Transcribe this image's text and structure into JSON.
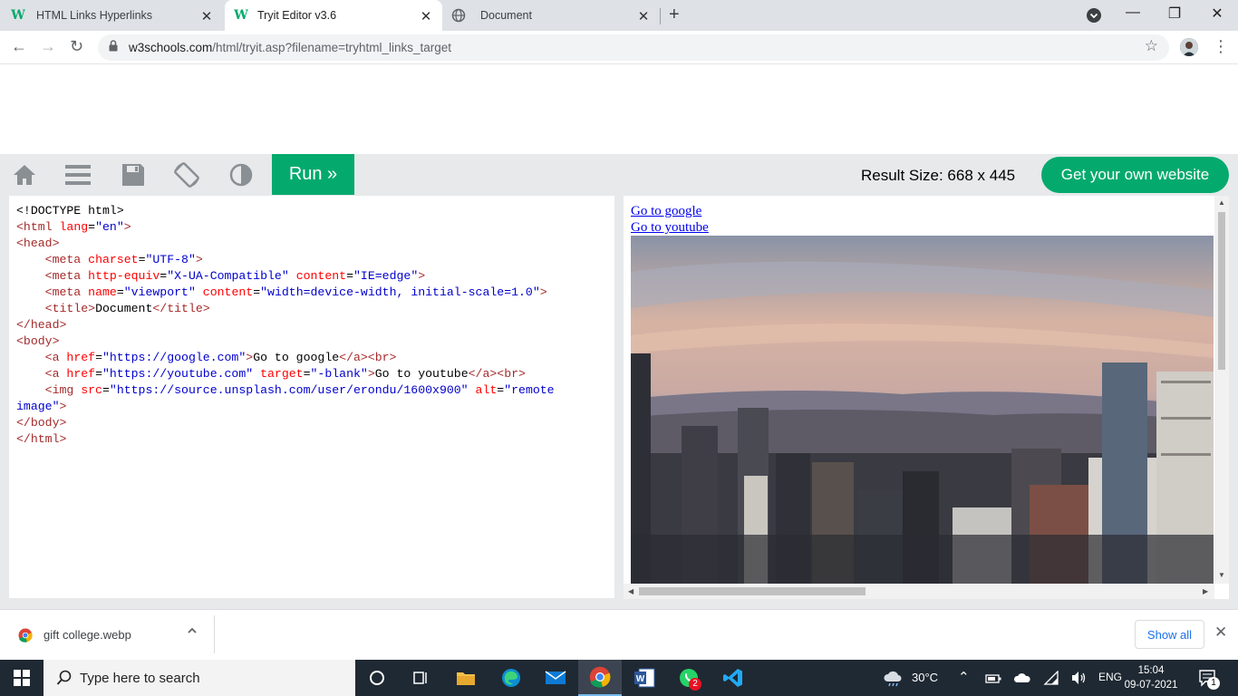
{
  "browser": {
    "tabs": [
      {
        "title": "HTML Links Hyperlinks",
        "active": false
      },
      {
        "title": "Tryit Editor v3.6",
        "active": true
      },
      {
        "title": "Document",
        "active": false
      }
    ],
    "url_host": "w3schools.com",
    "url_path": "/html/tryit.asp?filename=tryhtml_links_target"
  },
  "tryit": {
    "run_label": "Run »",
    "result_size": "Result Size: 668 x 445",
    "get_website_label": "Get your own website",
    "code_lines": {
      "l1": "<!DOCTYPE html>",
      "l11_text": "Go to google",
      "l12_text": "Go to youtube"
    },
    "result_links": [
      "Go to google",
      "Go to youtube"
    ]
  },
  "downloads": {
    "file_name": "gift college.webp",
    "show_all_label": "Show all"
  },
  "taskbar": {
    "search_placeholder": "Type here to search",
    "temperature": "30°C",
    "language": "ENG",
    "time": "15:04",
    "date": "09-07-2021",
    "whatsapp_badge": "2",
    "notification_count": "1"
  },
  "colors": {
    "w3_green": "#04aa6d",
    "toolbar_bg": "#e7e9eb",
    "taskbar_bg": "#1f2933"
  }
}
